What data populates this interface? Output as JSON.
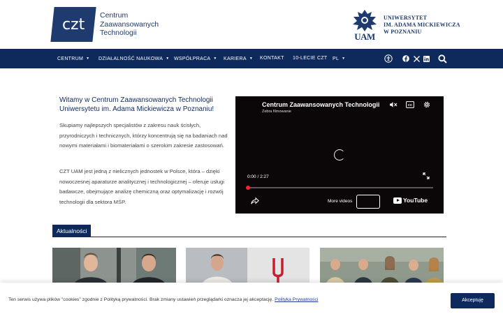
{
  "header": {
    "czt_logo": {
      "mark": "czt",
      "lines": [
        "Centrum",
        "Zaawansowanych",
        "Technologii"
      ]
    },
    "uam_logo": {
      "crest_text": "UAM",
      "lines": [
        "Uniwersytet",
        "im. Adama Mickiewicza",
        "w Poznaniu"
      ]
    }
  },
  "nav": {
    "items": [
      {
        "label": "CENTRUM",
        "has_dropdown": true
      },
      {
        "label": "DZIAŁALNOŚĆ NAUKOWA",
        "has_dropdown": true
      },
      {
        "label": "WSPÓŁPRACA",
        "has_dropdown": true
      },
      {
        "label": "KARIERA",
        "has_dropdown": true
      },
      {
        "label": "KONTAKT",
        "has_dropdown": false
      },
      {
        "label": "10-LECIE CZT",
        "has_dropdown": false
      },
      {
        "label": "PL",
        "has_dropdown": true
      }
    ],
    "icons": [
      "accessibility-icon",
      "facebook-icon",
      "x-icon",
      "linkedin-icon",
      "search-icon"
    ]
  },
  "intro": {
    "title": "Witamy w Centrum Zaawansowanych Technologii Uniwersytetu im. Adama Mickiewicza w Poznaniu!",
    "paragraphs": [
      "Skupiamy najlepszych specjalistów z zakresu nauk ścisłych, przyrodniczych i technicznych, którzy koncentrują się na badaniach nad nowymi materiałami i biomateriałami o szerokim zakresie zastosowań.",
      "CZT UAM jest jedną z nielicznych jednostek w Polsce, która – dzięki nowoczesnej aparaturze analitycznej i technologicznej – oferuje usługi badawcze, obejmujące analizę chemiczną oraz optymalizację i rozwój technologii dla sektora MŚP."
    ]
  },
  "video": {
    "title": "Centrum Zaawansowanych Technologii UAM",
    "subtitle": "Zebra filmowanie",
    "current_time": "0:00",
    "duration": "2:27",
    "progress": 0,
    "more_videos": "More videos",
    "brand": "YouTube"
  },
  "news": {
    "heading": "Aktualności",
    "items": [
      {
        "image": "two-men-portrait"
      },
      {
        "image": "man-and-tuning-fork-logo"
      },
      {
        "image": "group-of-researchers"
      }
    ]
  },
  "cookie": {
    "text": "Ten serwis używa plików \"cookies\" zgodnie z Polityką prywatności. Brak zmiany ustawień przeglądarki oznacza jej akceptację.",
    "link": "Polityka Prywatności",
    "button": "Akceptuję"
  },
  "colors": {
    "brand_navy": "#0e2a5c",
    "logo_blue": "#1e3a6e",
    "progress_red": "#ff1e2e"
  }
}
